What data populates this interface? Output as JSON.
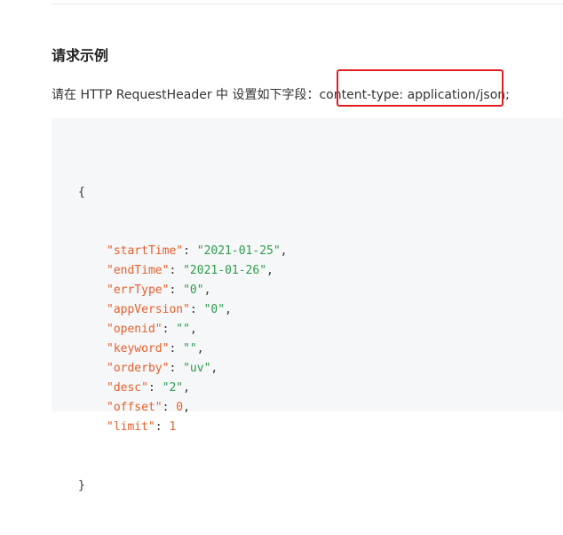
{
  "section": {
    "title": "请求示例",
    "description": "请在 HTTP RequestHeader 中 设置如下字段：content-type: application/json;"
  },
  "code": {
    "open_brace": "{",
    "close_brace": "}",
    "fields": [
      {
        "key": "\"startTime\"",
        "value": "\"2021-01-25\"",
        "type": "string"
      },
      {
        "key": "\"endTime\"",
        "value": "\"2021-01-26\"",
        "type": "string"
      },
      {
        "key": "\"errType\"",
        "value": "\"0\"",
        "type": "string"
      },
      {
        "key": "\"appVersion\"",
        "value": "\"0\"",
        "type": "string"
      },
      {
        "key": "\"openid\"",
        "value": "\"\"",
        "type": "string"
      },
      {
        "key": "\"keyword\"",
        "value": "\"\"",
        "type": "string"
      },
      {
        "key": "\"orderby\"",
        "value": "\"uv\"",
        "type": "string"
      },
      {
        "key": "\"desc\"",
        "value": "\"2\"",
        "type": "string"
      },
      {
        "key": "\"offset\"",
        "value": "0",
        "type": "number"
      },
      {
        "key": "\"limit\"",
        "value": "1",
        "type": "number"
      }
    ]
  },
  "colors": {
    "key": "#e5602d",
    "string": "#2e9b4c",
    "number": "#e5602d",
    "highlight_border": "#e02020",
    "code_background": "#f6f7f8"
  }
}
